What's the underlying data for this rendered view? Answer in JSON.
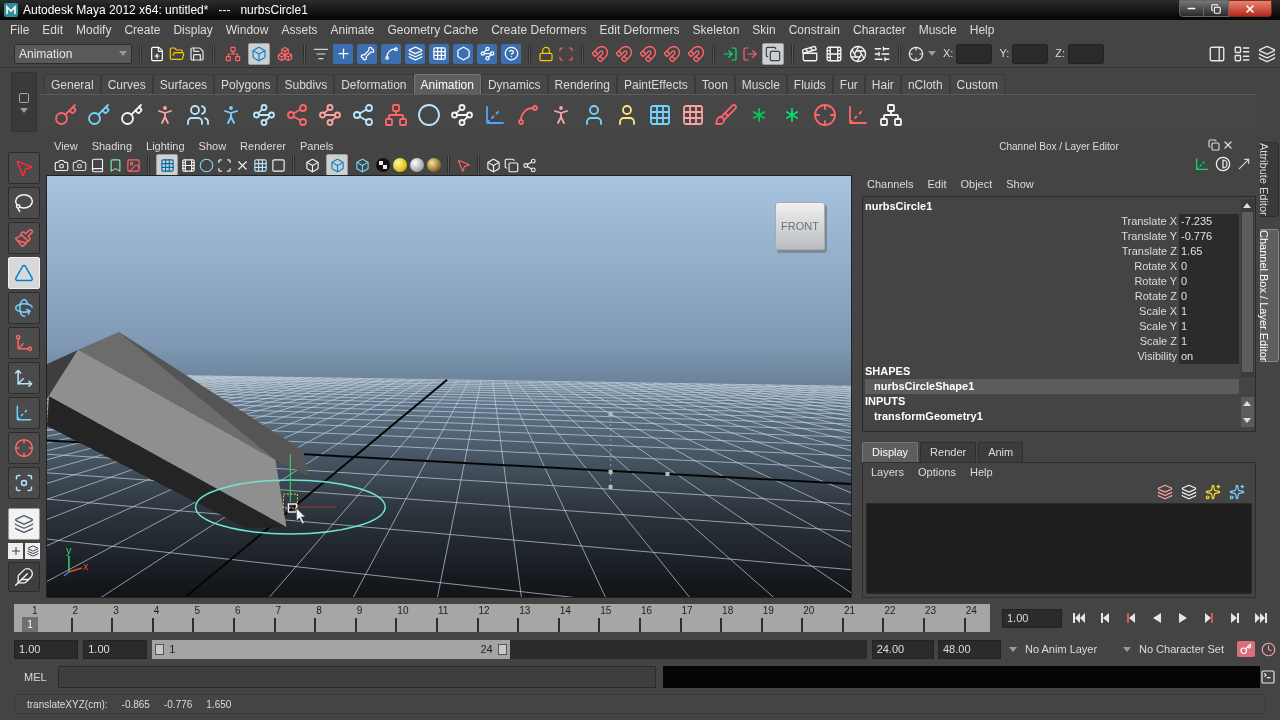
{
  "window": {
    "title": "Autodesk Maya 2012 x64: untitled*   ---   nurbsCircle1"
  },
  "menu_bar": [
    "File",
    "Edit",
    "Modify",
    "Create",
    "Display",
    "Window",
    "Assets",
    "Animate",
    "Geometry Cache",
    "Create Deformers",
    "Edit Deformers",
    "Skeleton",
    "Skin",
    "Constrain",
    "Character",
    "Muscle",
    "Help"
  ],
  "status_line": {
    "menu_set": "Animation",
    "selection_modes": [
      {
        "selected": false
      },
      {
        "selected": true
      },
      {
        "selected": false
      }
    ],
    "history": {
      "on": true
    },
    "transform_fields": [
      {
        "label": "X:"
      },
      {
        "label": "Y:"
      },
      {
        "label": "Z:"
      }
    ]
  },
  "shelf": {
    "tabs": [
      {
        "label": "General",
        "selected": false
      },
      {
        "label": "Curves",
        "selected": false
      },
      {
        "label": "Surfaces",
        "selected": false
      },
      {
        "label": "Polygons",
        "selected": false
      },
      {
        "label": "Subdivs",
        "selected": false
      },
      {
        "label": "Deformation",
        "selected": false
      },
      {
        "label": "Animation",
        "selected": true
      },
      {
        "label": "Dynamics",
        "selected": false
      },
      {
        "label": "Rendering",
        "selected": false
      },
      {
        "label": "PaintEffects",
        "selected": false
      },
      {
        "label": "Toon",
        "selected": false
      },
      {
        "label": "Muscle",
        "selected": false
      },
      {
        "label": "Fluids",
        "selected": false
      },
      {
        "label": "Fur",
        "selected": false
      },
      {
        "label": "Hair",
        "selected": false
      },
      {
        "label": "nCloth",
        "selected": false
      },
      {
        "label": "Custom",
        "selected": false
      }
    ]
  },
  "toolbox": {
    "tools": [
      {
        "selected": false
      },
      {
        "selected": false
      },
      {
        "selected": false
      },
      {
        "selected": true
      },
      {
        "selected": false
      },
      {
        "selected": false
      },
      {
        "selected": false
      },
      {
        "selected": false
      },
      {
        "selected": false
      },
      {
        "selected": false
      }
    ]
  },
  "viewport": {
    "menus": [
      "View",
      "Shading",
      "Lighting",
      "Show",
      "Renderer",
      "Panels"
    ],
    "grid": {
      "on": true
    },
    "shading_modes": [
      {
        "selected": false
      },
      {
        "selected": true
      },
      {
        "selected": false
      }
    ],
    "view_cube": "FRONT",
    "axis_labels": [
      "y",
      "x"
    ]
  },
  "channel_box": {
    "title": "Channel Box / Layer Editor",
    "menus": [
      "Channels",
      "Edit",
      "Object",
      "Show"
    ],
    "object": "nurbsCircle1",
    "channels": [
      {
        "name": "Translate X",
        "value": "-7.235"
      },
      {
        "name": "Translate Y",
        "value": "-0.776"
      },
      {
        "name": "Translate Z",
        "value": "1.65"
      },
      {
        "name": "Rotate X",
        "value": "0"
      },
      {
        "name": "Rotate Y",
        "value": "0"
      },
      {
        "name": "Rotate Z",
        "value": "0"
      },
      {
        "name": "Scale X",
        "value": "1"
      },
      {
        "name": "Scale Y",
        "value": "1"
      },
      {
        "name": "Scale Z",
        "value": "1"
      },
      {
        "name": "Visibility",
        "value": "on"
      }
    ],
    "sections": [
      {
        "heading": "SHAPES",
        "items": [
          {
            "label": "nurbsCircleShape1",
            "selected": true
          }
        ]
      },
      {
        "heading": "INPUTS",
        "items": [
          {
            "label": "transformGeometry1",
            "selected": false
          }
        ]
      }
    ]
  },
  "layer_editor": {
    "tabs": [
      {
        "label": "Display",
        "selected": true
      },
      {
        "label": "Render",
        "selected": false
      },
      {
        "label": "Anim",
        "selected": false
      }
    ],
    "menus": [
      "Layers",
      "Options",
      "Help"
    ]
  },
  "side_tabs": [
    {
      "label": "Attribute Editor",
      "selected": false
    },
    {
      "label": "Channel Box / Layer Editor",
      "selected": true
    }
  ],
  "time_slider": {
    "frames": [
      "1",
      "2",
      "3",
      "4",
      "5",
      "6",
      "7",
      "8",
      "9",
      "10",
      "11",
      "12",
      "13",
      "14",
      "15",
      "16",
      "17",
      "18",
      "19",
      "20",
      "21",
      "22",
      "23",
      "24"
    ],
    "level": 0,
    "playhead_frame": "1",
    "current_frame": "1.00"
  },
  "range_slider": {
    "start_time": "1.00",
    "range_start": "1.00",
    "handle_start": "1",
    "handle_end": "24",
    "level": 0.5,
    "range_end": "24.00",
    "end_time": "48.00",
    "anim_layer": "No Anim Layer",
    "character_set": "No Character Set"
  },
  "command_line": {
    "label": "MEL"
  },
  "help_line": {
    "label": "translateXYZ(cm):",
    "values": [
      "-0.865",
      "-0.776",
      "1.650"
    ]
  }
}
